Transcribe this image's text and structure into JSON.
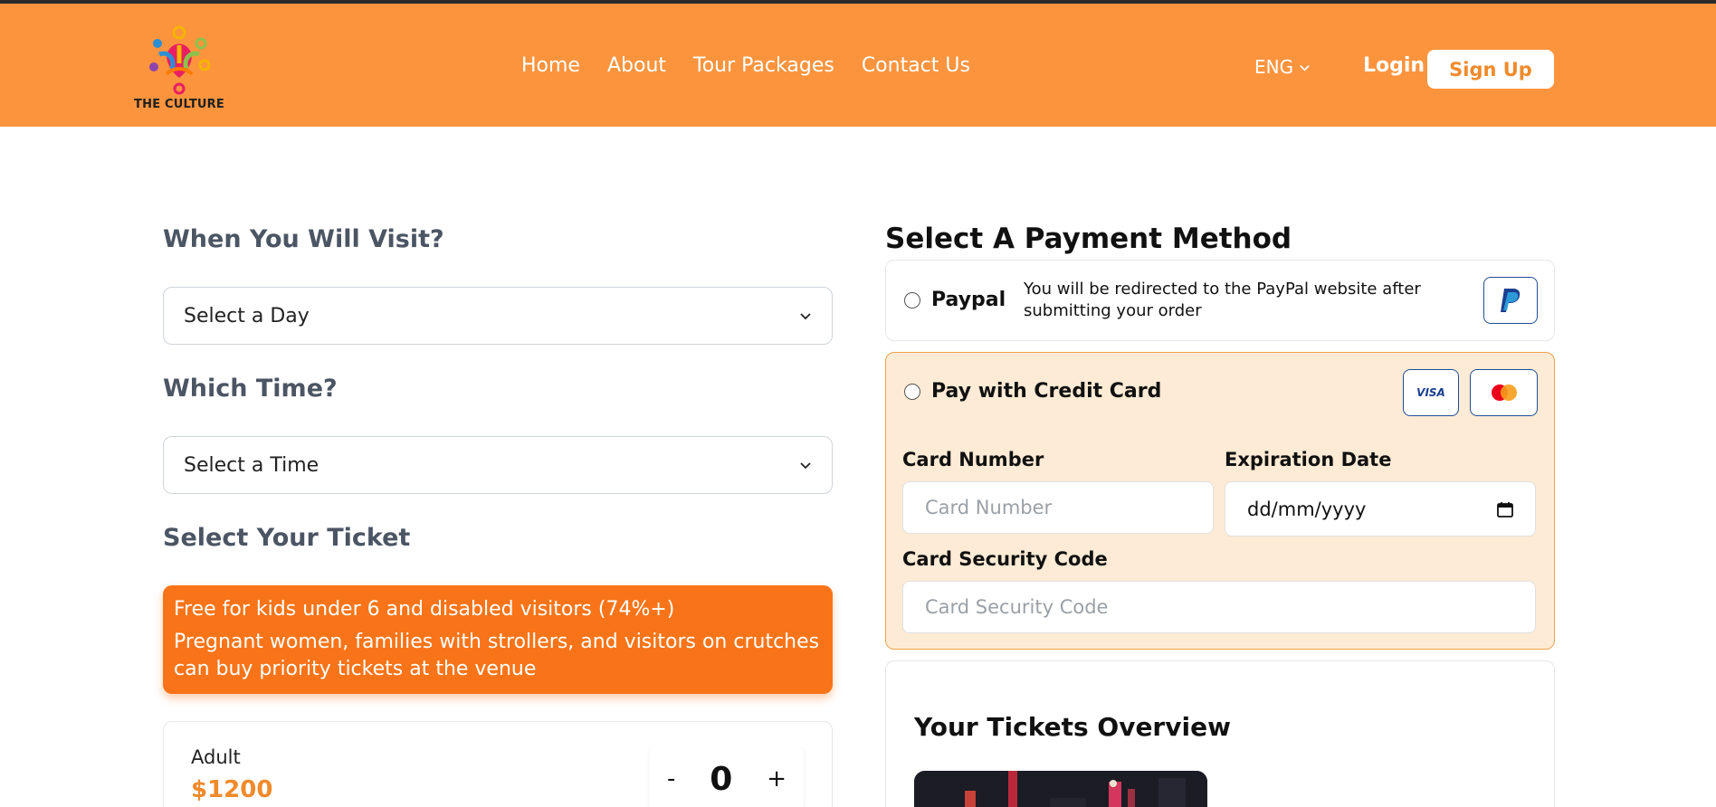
{
  "header": {
    "logo_text": "THE CULTURE",
    "nav": [
      "Home",
      "About",
      "Tour Packages",
      "Contact Us"
    ],
    "language": "ENG",
    "login": "Login",
    "signup": "Sign Up"
  },
  "booking": {
    "visit_title": "When You Will Visit?",
    "day_select": "Select a Day",
    "time_title": "Which Time?",
    "time_select": "Select a Time",
    "ticket_title": "Select Your Ticket",
    "notice_line1": "Free for kids under 6 and disabled visitors (74%+)",
    "notice_line2": "Pregnant women, families with strollers, and visitors on crutches can buy priority tickets at the venue",
    "ticket": {
      "name": "Adult",
      "price": "$1200",
      "minus": "-",
      "count": "0",
      "plus": "+"
    }
  },
  "payment": {
    "title": "Select A Payment Method",
    "paypal_label": "Paypal",
    "paypal_desc": "You will be redirected to the PayPal website after submitting your order",
    "credit_label": "Pay with Credit Card",
    "visa_text": "VISA",
    "card_number_label": "Card Number",
    "card_number_placeholder": "Card Number",
    "expiration_label": "Expiration Date",
    "expiration_value": "dd/mm/yyyy",
    "security_label": "Card Security Code",
    "security_placeholder": "Card Security Code"
  },
  "overview": {
    "title": "Your Tickets Overview"
  },
  "colors": {
    "header": "#fc943e",
    "accent": "#f97418",
    "price": "#f08a2a",
    "credit_bg": "#feebd5"
  }
}
